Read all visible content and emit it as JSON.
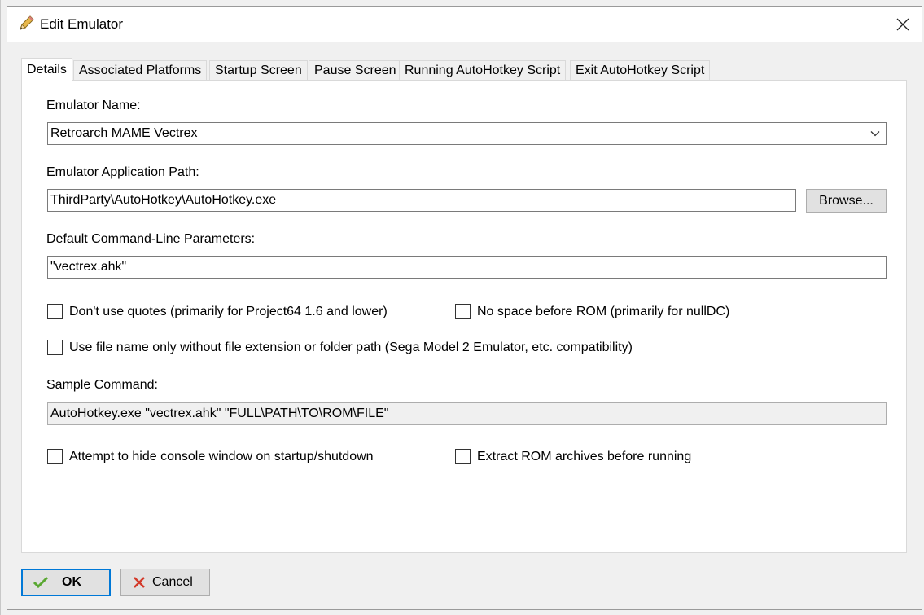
{
  "window": {
    "title": "Edit Emulator",
    "title_icon": "pencil-icon",
    "close_icon": "close-icon"
  },
  "tabs": [
    {
      "label": "Details",
      "active": true
    },
    {
      "label": "Associated Platforms",
      "active": false
    },
    {
      "label": "Startup Screen",
      "active": false
    },
    {
      "label": "Pause Screen",
      "active": false
    },
    {
      "label": "Running AutoHotkey Script",
      "active": false
    },
    {
      "label": "Exit AutoHotkey Script",
      "active": false
    }
  ],
  "details": {
    "emulator_name_label": "Emulator Name:",
    "emulator_name_value": "Retroarch MAME Vectrex",
    "app_path_label": "Emulator Application Path:",
    "app_path_value": "ThirdParty\\AutoHotkey\\AutoHotkey.exe",
    "browse_label": "Browse...",
    "cmdline_label": "Default Command-Line Parameters:",
    "cmdline_value": "\"vectrex.ahk\"",
    "dont_use_quotes_label": "Don't use quotes (primarily for Project64 1.6 and lower)",
    "no_space_label": "No space before ROM (primarily for nullDC)",
    "file_name_only_label": "Use file name only without file extension or folder path (Sega Model 2 Emulator, etc. compatibility)",
    "sample_command_label": "Sample Command:",
    "sample_command_value": "AutoHotkey.exe \"vectrex.ahk\" \"FULL\\PATH\\TO\\ROM\\FILE\"",
    "hide_console_label": "Attempt to hide console window on startup/shutdown",
    "extract_rom_label": "Extract ROM archives before running"
  },
  "footer": {
    "ok_label": "OK",
    "cancel_label": "Cancel",
    "ok_icon": "checkmark-icon",
    "cancel_icon": "x-icon"
  },
  "colors": {
    "focus_border": "#0078d7",
    "ok_check": "#5aa832",
    "cancel_x": "#d33a2a"
  }
}
